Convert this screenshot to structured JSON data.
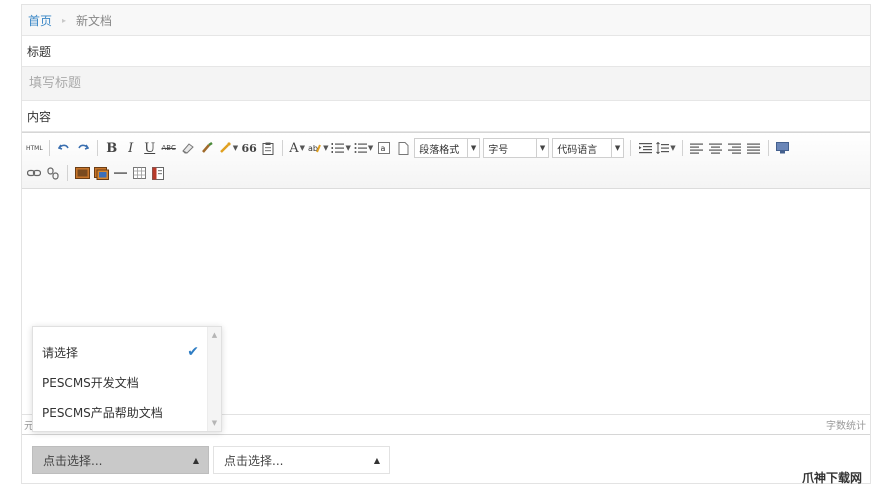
{
  "breadcrumb": {
    "home": "首页",
    "separator": "▸",
    "current": "新文档"
  },
  "form": {
    "title_label": "标题",
    "title_placeholder": "填写标题",
    "title_value": "",
    "content_label": "内容"
  },
  "editor": {
    "toolbar": {
      "html_label": "HTML",
      "quote_label": "66",
      "font_color_label": "A",
      "paragraph_select": "段落格式",
      "font_size_select": "字号",
      "code_lang_select": "代码语言"
    },
    "status_left": "元",
    "word_count": "字数统计"
  },
  "category_selects": [
    {
      "label": "点击选择...",
      "caret": "▲",
      "active": true
    },
    {
      "label": "点击选择...",
      "caret": "▲",
      "active": false
    }
  ],
  "dropdown": {
    "options": [
      {
        "label": "请选择",
        "selected": true
      },
      {
        "label": "PESCMS开发文档",
        "selected": false
      },
      {
        "label": "PESCMS产品帮助文档",
        "selected": false
      }
    ],
    "check_mark": "✔"
  },
  "watermark": "爪神下载网",
  "colors": {
    "link": "#3a87c6",
    "check": "#2e7dc4",
    "active_select": "#c9c9c9"
  }
}
